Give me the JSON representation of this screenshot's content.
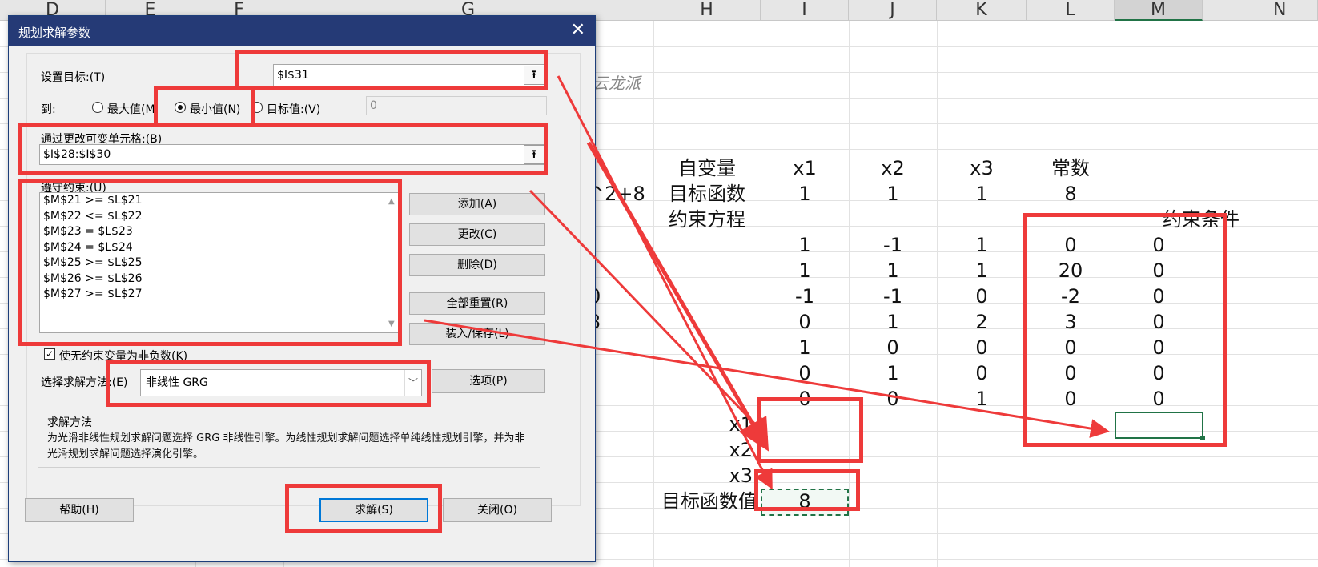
{
  "sheet": {
    "columns": [
      "D",
      "E",
      "F",
      "G",
      "H",
      "I",
      "J",
      "K",
      "L",
      "M",
      "N"
    ],
    "watermark": "云龙派",
    "partial_left": {
      "r7": "^2+8",
      "r11": "0",
      "r12": "3"
    },
    "labels": {
      "var_header": "自变量",
      "obj_func": "目标函数",
      "constraint_eq": "约束方程",
      "constraint_cond": "约束条件",
      "const": "常数",
      "x1": "x1",
      "x2": "x2",
      "x3": "x3",
      "obj_value": "目标函数值"
    },
    "header_row": [
      "x1",
      "x2",
      "x3",
      "常数"
    ],
    "obj_row": [
      "1",
      "1",
      "1",
      "8"
    ],
    "constraint_rows": [
      [
        "1",
        "-1",
        "1",
        "0",
        "0"
      ],
      [
        "1",
        "1",
        "1",
        "20",
        "0"
      ],
      [
        "-1",
        "-1",
        "0",
        "-2",
        "0"
      ],
      [
        "0",
        "1",
        "2",
        "3",
        "0"
      ],
      [
        "1",
        "0",
        "0",
        "0",
        "0"
      ],
      [
        "0",
        "1",
        "0",
        "0",
        "0"
      ],
      [
        "0",
        "0",
        "1",
        "0",
        "0"
      ]
    ],
    "obj_result": "8"
  },
  "dialog": {
    "title": "规划求解参数",
    "close_glyph": "✕",
    "target_label": "设置目标:(T)",
    "target_value": "$I$31",
    "to_label": "到:",
    "radio_max": "最大值(M",
    "radio_min": "最小值(N)",
    "radio_value": "目标值:(V)",
    "value_field": "0",
    "change_label": "通过更改可变单元格:(B)",
    "change_value": "$I$28:$I$30",
    "constraints_label": "遵守约束:(U)",
    "constraints": [
      "$M$21 >= $L$21",
      "$M$22 <= $L$22",
      "$M$23 = $L$23",
      "$M$24 = $L$24",
      "$M$25 >= $L$25",
      "$M$26 >= $L$26",
      "$M$27 >= $L$27"
    ],
    "btn_add": "添加(A)",
    "btn_change": "更改(C)",
    "btn_delete": "删除(D)",
    "btn_reset": "全部重置(R)",
    "btn_load": "装入/保存(L)",
    "nonneg_label": "使无约束变量为非负数(K)",
    "nonneg_checked": "✓",
    "method_label": "选择求解方法:(E)",
    "method_value": "非线性 GRG",
    "btn_options": "选项(P)",
    "method_group_title": "求解方法",
    "method_desc": "为光滑非线性规划求解问题选择 GRG 非线性引擎。为线性规划求解问题选择单纯线性规划引擎，并为非光滑规划求解问题选择演化引擎。",
    "btn_help": "帮助(H)",
    "btn_solve": "求解(S)",
    "btn_close": "关闭(O)"
  },
  "colors": {
    "annotation_red": "#ee3a3a",
    "title_bar": "#253a76",
    "excel_green": "#217346"
  }
}
